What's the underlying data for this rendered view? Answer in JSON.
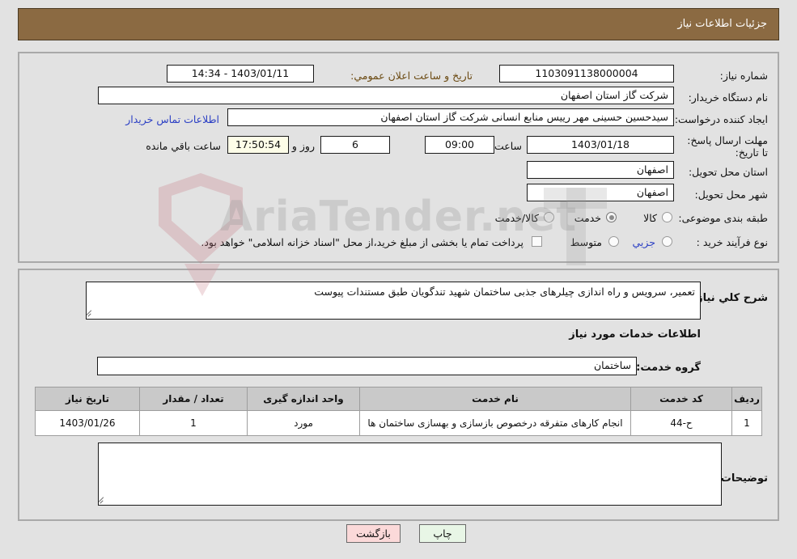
{
  "header": {
    "title": "جزئیات اطلاعات نیاز"
  },
  "watermark": {
    "text": "AriaTender.net"
  },
  "top_panel": {
    "need_number_label": "شماره نیاز:",
    "need_number_value": "1103091138000004",
    "announce_label": "تاریخ و ساعت اعلان عمومي:",
    "announce_value": "1403/01/11 - 14:34",
    "buyer_org_label": "نام دستگاه خریدار:",
    "buyer_org_value": "شرکت گاز استان اصفهان",
    "creator_label": "ایجاد کننده درخواست:",
    "creator_value": "سیدحسین حسینی مهر رییس منابع انسانی شرکت گاز استان اصفهان",
    "contact_link": "اطلاعات تماس خریدار",
    "deadline_label": "مهلت ارسال پاسخ: تا تاریخ:",
    "deadline_date": "1403/01/18",
    "hour_label": "ساعت",
    "deadline_time": "09:00",
    "remaining_days": "6",
    "days_and_label": "روز و",
    "remaining_time": "17:50:54",
    "remaining_suffix": "ساعت باقي مانده",
    "province_label": "استان محل تحویل:",
    "province_value": "اصفهان",
    "city_label": "شهر محل تحویل:",
    "city_value": "اصفهان",
    "category_label": "طبقه بندی موضوعی:",
    "category_options": [
      "کالا",
      "خدمت",
      "کالا/خدمت"
    ],
    "category_selected": "خدمت",
    "process_label": "نوع فرآیند خرید :",
    "process_options": [
      "جزیي",
      "متوسط"
    ],
    "process_selected": "",
    "treasury_checkbox_label": "پرداخت تمام یا بخشی از مبلغ خرید،از محل \"اسناد خزانه اسلامی\" خواهد بود.",
    "treasury_checked": false
  },
  "bottom_panel": {
    "summary_label": "شرح کلي نیاز:",
    "summary_value": "تعمیر، سرویس و راه اندازی چیلرهای جذبی ساختمان شهید تندگویان طبق مستندات پیوست",
    "services_heading": "اطلاعات خدمات مورد نیاز",
    "service_group_label": "گروه خدمت:",
    "service_group_value": "ساختمان",
    "buyer_notes_label": "توضیحات خریدار:",
    "buyer_notes_value": ""
  },
  "table": {
    "columns": [
      "ردیف",
      "کد خدمت",
      "نام خدمت",
      "واحد اندازه گیری",
      "تعداد / مقدار",
      "تاریخ نیاز"
    ],
    "rows": [
      {
        "row_no": "1",
        "service_code": "ح-44",
        "service_name": "انجام کارهای متفرقه درخصوص بازسازی و بهسازی ساختمان ها",
        "unit": "مورد",
        "quantity": "1",
        "need_date": "1403/01/26"
      }
    ]
  },
  "footer": {
    "print_label": "چاپ",
    "back_label": "بازگشت"
  },
  "colors": {
    "header_bar": "#8b6a42",
    "page_bg": "#e2e2e2",
    "link": "#2b3fc4",
    "table_header": "#c9c9c9",
    "back_button": "#fbd9d9",
    "print_button": "#e8f6e6",
    "timer_field": "#fdfde8"
  }
}
